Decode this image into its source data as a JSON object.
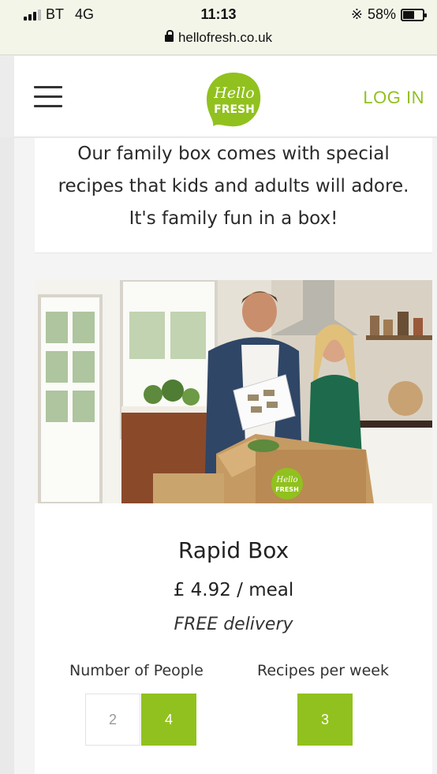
{
  "status_bar": {
    "carrier": "BT",
    "network": "4G",
    "time": "11:13",
    "battery": "58%",
    "battery_level": 0.58,
    "url": "hellofresh.co.uk",
    "icons": [
      "signal-icon",
      "bluetooth-icon",
      "battery-icon",
      "lock-icon"
    ]
  },
  "header": {
    "logo_line1": "Hello",
    "logo_line2": "FRESH",
    "login_label": "LOG IN",
    "menu_icon": "hamburger-menu-icon"
  },
  "intro": {
    "lines": [
      "Our family box comes with special",
      "recipes that kids and adults will adore.",
      "It's family fun in a box!"
    ]
  },
  "box": {
    "title": "Rapid Box",
    "price": "£ 4.92 / meal",
    "delivery": "FREE delivery",
    "box_logo_line1": "Hello",
    "box_logo_line2": "FRESH",
    "people_label": "Number of People",
    "people_options": [
      "2",
      "4"
    ],
    "people_selected": "4",
    "recipes_label": "Recipes per week",
    "recipes_options": [
      "3"
    ],
    "recipes_selected": "3"
  },
  "colors": {
    "brand_green": "#91c11e",
    "status_bar_bg": "#f3f5e9",
    "page_bg": "#f4f4f4"
  }
}
